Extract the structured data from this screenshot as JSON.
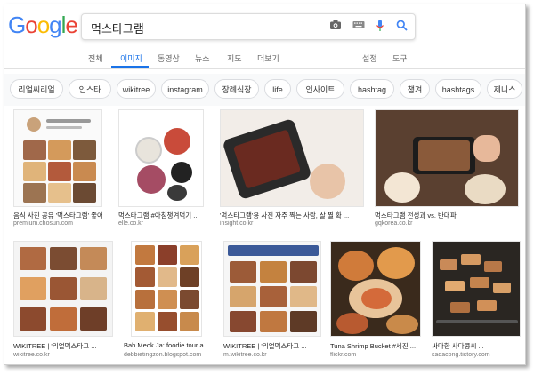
{
  "search": {
    "query": "먹스타그램"
  },
  "logo": {
    "letters": [
      "G",
      "o",
      "o",
      "g",
      "l",
      "e"
    ],
    "colors": [
      "#4285F4",
      "#EA4335",
      "#FBBC05",
      "#4285F4",
      "#34A853",
      "#EA4335"
    ]
  },
  "icons": {
    "camera": "camera-icon",
    "keyboard": "keyboard-icon",
    "mic": "microphone-icon",
    "search": "search-icon"
  },
  "tabs": {
    "all": "전체",
    "images": "이미지",
    "videos": "동영상",
    "news": "뉴스",
    "maps": "지도",
    "more": "더보기",
    "settings": "설정",
    "tools": "도구"
  },
  "chips": [
    "리얼씨리얼",
    "인스타",
    "wikitree",
    "instagram",
    "장례식장",
    "life",
    "인사이트",
    "hashtag",
    "챙겨",
    "hashtags",
    "제니스"
  ],
  "results": [
    {
      "caption": "음식 사진 공유 '먹스타그램' 좋아 ...",
      "source": "premium.chosun.com"
    },
    {
      "caption": "먹스타그램 #아침챙겨먹기 ...",
      "source": "elle.co.kr"
    },
    {
      "caption": "'먹스타그램'용 사진 자주 찍는 사람, 살 찔 확 ...",
      "source": "insight.co.kr"
    },
    {
      "caption": "먹스타그램 전성과 vs. 반대파",
      "source": "gqkorea.co.kr"
    },
    {
      "caption": "WIKITREE | '리얼먹스타그 ...",
      "source": "wikitree.co.kr"
    },
    {
      "caption": "Bab Meok Ja: foodie tour a ...",
      "source": "debbietingzon.blogspot.com"
    },
    {
      "caption": "WIKITREE | '리얼먹스타그 ...",
      "source": "m.wikitree.co.kr"
    },
    {
      "caption": "Tuna Shrimp Bucket #세진 ...",
      "source": "flickr.com"
    },
    {
      "caption": "싸다한 사다콩씨 ...",
      "source": "sadacong.tistory.com"
    }
  ]
}
